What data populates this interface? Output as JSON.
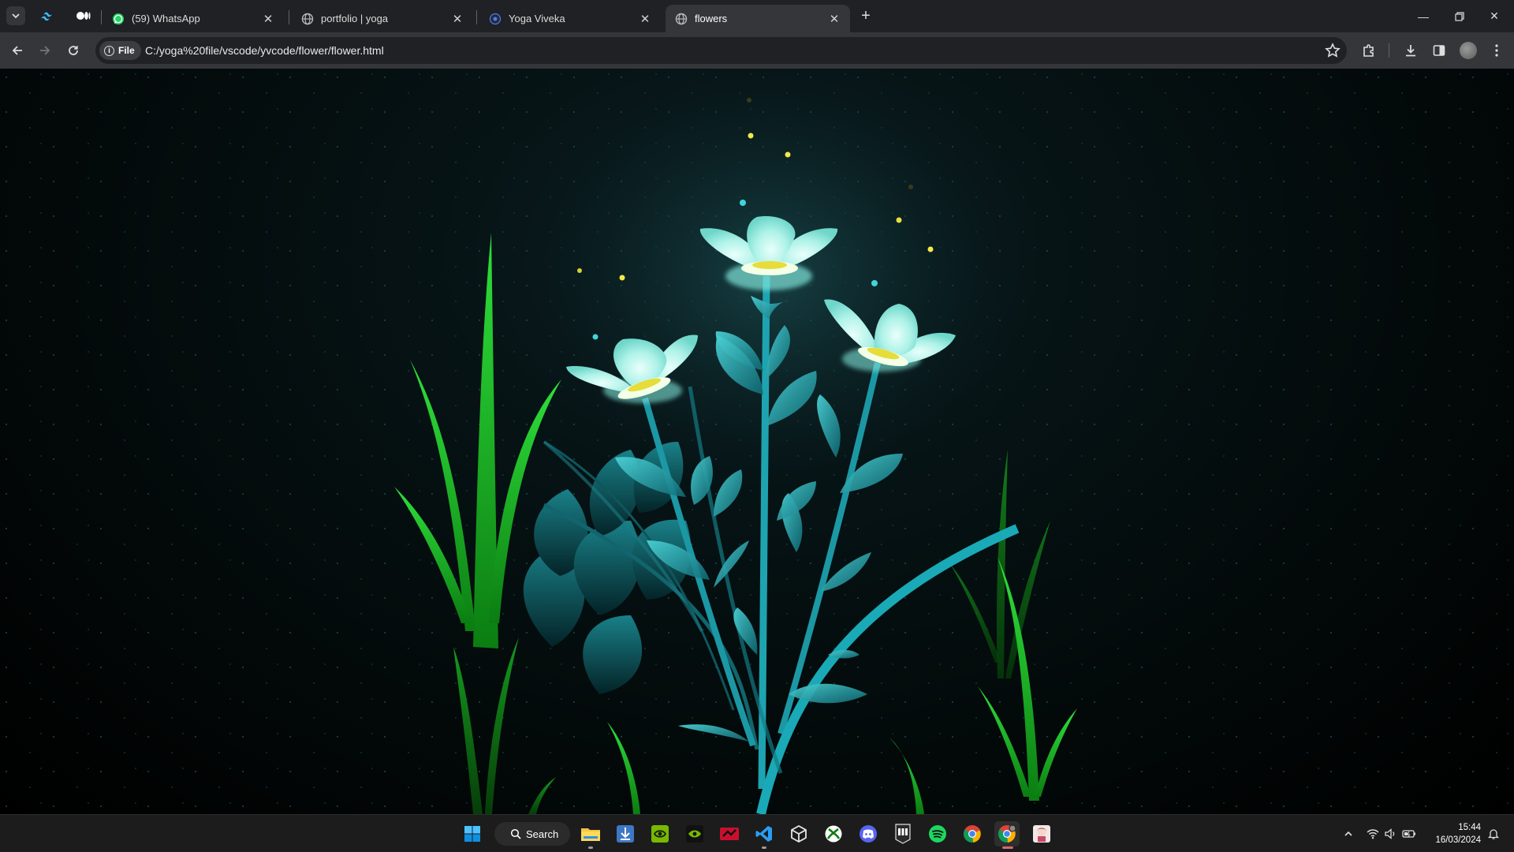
{
  "browser": {
    "tabs": [
      {
        "label": "(59) WhatsApp",
        "favicon": "whatsapp-icon",
        "active": false
      },
      {
        "label": "portfolio | yoga",
        "favicon": "globe-icon",
        "active": false
      },
      {
        "label": "Yoga Viveka",
        "favicon": "site-icon",
        "active": false
      },
      {
        "label": "flowers",
        "favicon": "globe-icon",
        "active": true
      }
    ],
    "pinned_tabs": [
      "tailwind-icon",
      "medium-icon"
    ],
    "address": {
      "chip_label": "File",
      "url": "C:/yoga%20file/vscode/yvcode/flower/flower.html"
    }
  },
  "page": {
    "scene": "glowing-flowers",
    "colors": {
      "flower": "#7fe3d8",
      "leaf": "#1fa3ae",
      "grass": "#1cc428",
      "pollen": "#f2e94a",
      "background": "#031011"
    }
  },
  "taskbar": {
    "search_label": "Search",
    "apps": [
      "file-explorer-icon",
      "visual-studio-installer-icon",
      "nvidia-geforce-icon",
      "nvidia-control-icon",
      "rog-armoury-icon",
      "vscode-icon",
      "3d-box-icon",
      "xbox-icon",
      "discord-icon",
      "epic-games-icon",
      "spotify-icon",
      "chrome-icon",
      "chrome-profile-icon",
      "character-app-icon"
    ],
    "clock": {
      "time": "15:44",
      "date": "16/03/2024"
    }
  }
}
